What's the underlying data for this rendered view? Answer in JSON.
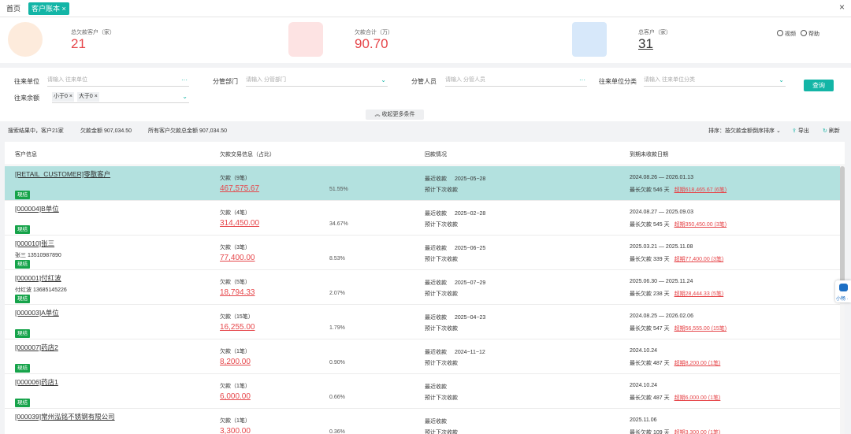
{
  "tabs": [
    {
      "label": "首页",
      "active": false
    },
    {
      "label": "客户账本",
      "active": true,
      "close": "×"
    }
  ],
  "window_close": "×",
  "summary": {
    "cards": [
      {
        "label": "总欠款客户（家）",
        "value": "21",
        "color": "#e6464a",
        "icon": "customer-icon"
      },
      {
        "label": "欠款合计（万）",
        "value": "90.70",
        "color": "#e6464a",
        "icon": "money-icon"
      },
      {
        "label": "总客户（家）",
        "value": "31",
        "color": "#333333",
        "icon": "building-icon"
      }
    ],
    "video_label": "视频",
    "help_label": "帮助"
  },
  "filters": {
    "counterparty": {
      "label": "往来单位",
      "placeholder": "请输入 往来单位",
      "suffix": "···"
    },
    "department": {
      "label": "分管部门",
      "placeholder": "请输入 分管部门"
    },
    "manager": {
      "label": "分管人员",
      "placeholder": "请输入 分管人员",
      "suffix": "···"
    },
    "category": {
      "label": "往来单位分类",
      "placeholder": "请输入 往来单位分类"
    },
    "balance": {
      "label": "往来余额",
      "tags": [
        "小于0 ×",
        "大于0 ×"
      ]
    },
    "query_button": "查询",
    "collapse_label": "收起更多条件"
  },
  "result_bar": {
    "searching": "搜索结果中，客户21家",
    "debt_amount": "欠款金额 907,034.50",
    "total_debt": "所有客户欠款总金额 907,034.50",
    "sort": "排序：按欠款金额倒序排序",
    "export": "导出",
    "refresh": "刷新"
  },
  "table": {
    "headers": [
      "客户信息",
      "欠款交易信息（占比）",
      "回款情况",
      "到期未收款日期"
    ],
    "labels": {
      "recent_payment": "最近收款",
      "next_payment": "预计下次收款",
      "longest_prefix": "最长欠款",
      "overdue_prefix": "超期"
    },
    "rows": [
      {
        "name": "[RETAIL_CUSTOMER]零散客户",
        "contact": "",
        "badge": "現结",
        "debt_label": "欠款（9笔）",
        "amount": "467,575.67",
        "pct": "51.55%",
        "recent_date": "2025−05−28",
        "range": "2024.08.26 — 2026.01.13",
        "longest": "最长欠款 546 天",
        "overdue": "超期618,465.67 (6笔)",
        "selected": true
      },
      {
        "name": "[000004]B单位",
        "contact": "",
        "badge": "現结",
        "debt_label": "欠款（4笔）",
        "amount": "314,450.00",
        "pct": "34.67%",
        "recent_date": "2025−02−28",
        "range": "2024.08.27 — 2025.09.03",
        "longest": "最长欠款 545 天",
        "overdue": "超期350,450.00 (3笔)",
        "selected": false
      },
      {
        "name": "[000010]张三",
        "contact": "张三   13510987890",
        "badge": "現结",
        "debt_label": "欠款（3笔）",
        "amount": "77,400.00",
        "pct": "8.53%",
        "recent_date": "2025−06−25",
        "range": "2025.03.21 — 2025.11.08",
        "longest": "最长欠款 339 天",
        "overdue": "超期77,400.00 (3笔)",
        "selected": false
      },
      {
        "name": "[000001]付红波",
        "contact": "付红波   13685145226",
        "badge": "現结",
        "debt_label": "欠款（5笔）",
        "amount": "18,794.33",
        "pct": "2.07%",
        "recent_date": "2025−07−29",
        "range": "2025.06.30 — 2025.11.24",
        "longest": "最长欠款 238 天",
        "overdue": "超期28,444.33 (5笔)",
        "selected": false
      },
      {
        "name": "[000003]A单位",
        "contact": "",
        "badge": "現结",
        "debt_label": "欠款（15笔）",
        "amount": "16,255.00",
        "pct": "1.79%",
        "recent_date": "2025−04−23",
        "range": "2024.08.25 — 2026.02.06",
        "longest": "最长欠款 547 天",
        "overdue": "超期56,555.00 (15笔)",
        "selected": false
      },
      {
        "name": "[000007]药店2",
        "contact": "",
        "badge": "現结",
        "debt_label": "欠款（1笔）",
        "amount": "8,200.00",
        "pct": "0.90%",
        "recent_date": "2024−11−12",
        "range": "2024.10.24",
        "longest": "最长欠款 487 天",
        "overdue": "超期8,200.00 (1笔)",
        "selected": false
      },
      {
        "name": "[000006]药店1",
        "contact": "",
        "badge": "現结",
        "debt_label": "欠款（1笔）",
        "amount": "6,000.00",
        "pct": "0.66%",
        "recent_date": "",
        "range": "2024.10.24",
        "longest": "最长欠款 487 天",
        "overdue": "超期6,000.00 (1笔)",
        "selected": false
      },
      {
        "name": "[000039]常州泓铭不锈钢有限公司",
        "contact": "",
        "badge": "",
        "debt_label": "欠款（1笔）",
        "amount": "3,300.00",
        "pct": "0.36%",
        "recent_date": "",
        "range": "2025.11.06",
        "longest": "最长欠款 109 天",
        "overdue": "超期3,300.00 (1笔)",
        "selected": false
      }
    ]
  },
  "widget_label": "小畅 ·",
  "colors": {
    "accent": "#13b5a6",
    "danger": "#e6464a",
    "badge": "#16a34a",
    "selected_row": "#b3e1df"
  }
}
